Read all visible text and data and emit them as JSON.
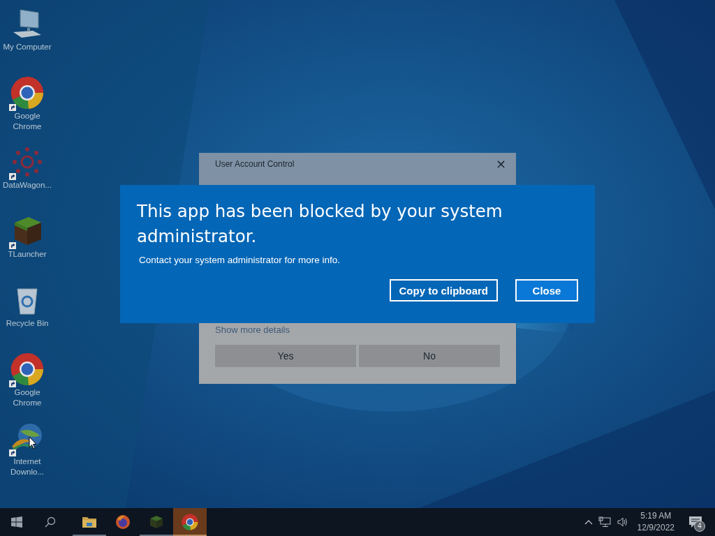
{
  "desktop_icons": [
    {
      "kind": "computer",
      "label": "My Computer",
      "shortcut": false
    },
    {
      "kind": "chrome",
      "label": "Google Chrome",
      "shortcut": true
    },
    {
      "kind": "datawagon",
      "label": "DataWagon...",
      "shortcut": true
    },
    {
      "kind": "tlauncher",
      "label": "TLauncher",
      "shortcut": true
    },
    {
      "kind": "recycle",
      "label": "Recycle Bin",
      "shortcut": false
    },
    {
      "kind": "chrome",
      "label": "Google Chrome",
      "shortcut": true
    },
    {
      "kind": "idm",
      "label": "Internet Downlo...",
      "shortcut": true
    }
  ],
  "uac_dialog": {
    "title": "User Account Control",
    "close": "×",
    "details_link": "Show more details",
    "buttons": [
      "Yes",
      "No"
    ]
  },
  "blocked_dialog": {
    "title": "This app has been blocked by your system administrator.",
    "message": "Contact your system administrator for more info.",
    "buttons": [
      {
        "label": "Copy to clipboard",
        "primary": false
      },
      {
        "label": "Close",
        "primary": true
      }
    ]
  },
  "taskbar": {
    "apps": [
      {
        "kind": "explorer",
        "running": true,
        "selected": false
      },
      {
        "kind": "firefox",
        "running": false,
        "selected": false
      },
      {
        "kind": "tlauncher",
        "running": true,
        "selected": false
      },
      {
        "kind": "chrome",
        "running": true,
        "selected": true
      }
    ],
    "time": "5:19 AM",
    "date": "12/9/2022",
    "notifications": "4"
  }
}
